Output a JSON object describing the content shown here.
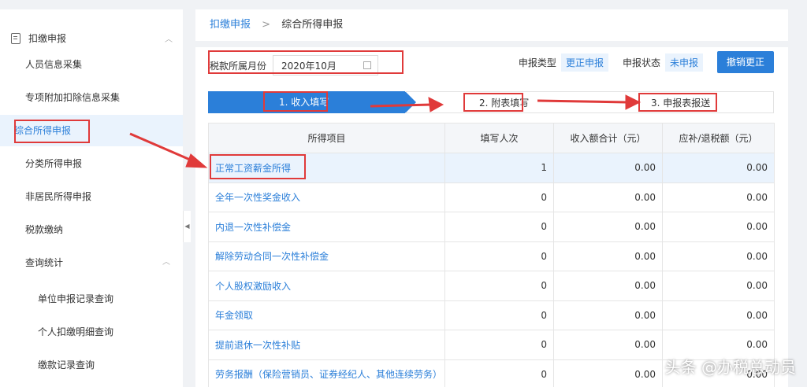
{
  "sidebar": {
    "group1": "扣缴申报",
    "items": [
      {
        "label": "人员信息采集"
      },
      {
        "label": "专项附加扣除信息采集"
      },
      {
        "label": "综合所得申报"
      },
      {
        "label": "分类所得申报"
      },
      {
        "label": "非居民所得申报"
      },
      {
        "label": "税款缴纳"
      },
      {
        "label": "查询统计"
      },
      {
        "label": "单位申报记录查询"
      },
      {
        "label": "个人扣缴明细查询"
      },
      {
        "label": "缴款记录查询"
      }
    ],
    "active_index": 2
  },
  "breadcrumb": {
    "parent": "扣缴申报",
    "sep": ">",
    "current": "综合所得申报"
  },
  "period": {
    "label": "税款所属月份",
    "value": "2020年10月"
  },
  "status": {
    "type_label": "申报类型",
    "type_value": "更正申报",
    "state_label": "申报状态",
    "state_value": "未申报",
    "cancel_button": "撤销更正"
  },
  "steps": {
    "step1": "1. 收入填写",
    "step2": "2. 附表填写",
    "step3": "3. 申报表报送"
  },
  "table": {
    "headers": [
      "所得项目",
      "填写人次",
      "收入额合计（元）",
      "应补/退税额（元）"
    ],
    "rows": [
      {
        "name": "正常工资薪金所得",
        "count": "1",
        "income": "0.00",
        "tax": "0.00"
      },
      {
        "name": "全年一次性奖金收入",
        "count": "0",
        "income": "0.00",
        "tax": "0.00"
      },
      {
        "name": "内退一次性补偿金",
        "count": "0",
        "income": "0.00",
        "tax": "0.00"
      },
      {
        "name": "解除劳动合同一次性补偿金",
        "count": "0",
        "income": "0.00",
        "tax": "0.00"
      },
      {
        "name": "个人股权激励收入",
        "count": "0",
        "income": "0.00",
        "tax": "0.00"
      },
      {
        "name": "年金领取",
        "count": "0",
        "income": "0.00",
        "tax": "0.00"
      },
      {
        "name": "提前退休一次性补贴",
        "count": "0",
        "income": "0.00",
        "tax": "0.00"
      },
      {
        "name": "劳务报酬（保险营销员、证券经纪人、其他连续劳务）",
        "count": "0",
        "income": "0.00",
        "tax": "0.00"
      }
    ]
  },
  "watermark": "头条 @办税总动员",
  "colors": {
    "accent": "#2b7fd9",
    "annotation": "#e03a3a",
    "active_bg": "#eaf3fd"
  }
}
